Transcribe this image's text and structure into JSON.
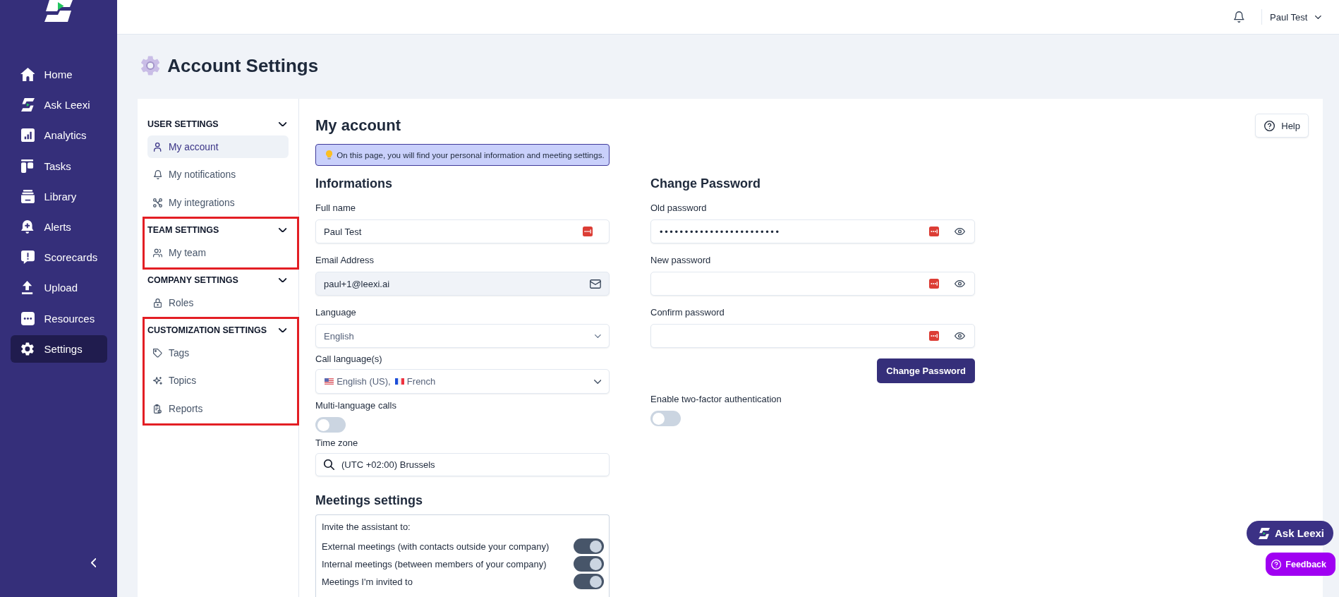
{
  "sidebar": {
    "items": [
      {
        "label": "Home",
        "selected": false
      },
      {
        "label": "Ask Leexi",
        "selected": false
      },
      {
        "label": "Analytics",
        "selected": false
      },
      {
        "label": "Tasks",
        "selected": false
      },
      {
        "label": "Library",
        "selected": false
      },
      {
        "label": "Alerts",
        "selected": false
      },
      {
        "label": "Scorecards",
        "selected": false
      },
      {
        "label": "Upload",
        "selected": false
      },
      {
        "label": "Resources",
        "selected": false
      },
      {
        "label": "Settings",
        "selected": true
      }
    ]
  },
  "top_bar": {
    "user_name": "Paul Test"
  },
  "page_title": "Account Settings",
  "settings_nav": {
    "sections": [
      {
        "title": "USER SETTINGS",
        "expanded": true,
        "highlighted": false,
        "items": [
          {
            "label": "My account",
            "selected": true
          },
          {
            "label": "My notifications",
            "selected": false
          },
          {
            "label": "My integrations",
            "selected": false
          }
        ]
      },
      {
        "title": "TEAM SETTINGS",
        "expanded": true,
        "highlighted": true,
        "items": [
          {
            "label": "My team",
            "selected": false
          }
        ]
      },
      {
        "title": "COMPANY SETTINGS",
        "expanded": true,
        "highlighted": false,
        "items": [
          {
            "label": "Roles",
            "selected": false
          }
        ]
      },
      {
        "title": "CUSTOMIZATION SETTINGS",
        "expanded": true,
        "highlighted": true,
        "items": [
          {
            "label": "Tags",
            "selected": false
          },
          {
            "label": "Topics",
            "selected": false
          },
          {
            "label": "Reports",
            "selected": false
          }
        ]
      }
    ]
  },
  "account": {
    "title": "My account",
    "help_button": "Help",
    "notice": "On this page, you will find your personal information and meeting settings.",
    "informations": {
      "title": "Informations",
      "fields": [
        {
          "kind": "text",
          "label": "Full name",
          "value": "Paul Test",
          "disabled": false
        },
        {
          "kind": "email",
          "label": "Email Address",
          "value": "paul+1@leexi.ai",
          "disabled": true
        },
        {
          "kind": "select",
          "label": "Language",
          "value": "English",
          "disabled": false
        },
        {
          "kind": "multiselect",
          "label": "Call language(s)",
          "options": [
            {
              "label": "English (US),"
            },
            {
              "label": "French"
            }
          ],
          "disabled": false
        },
        {
          "kind": "toggle",
          "label": "Multi-language calls",
          "on": false
        },
        {
          "kind": "search",
          "label": "Time zone",
          "value": "(UTC +02:00) Brussels",
          "disabled": false
        }
      ]
    },
    "meetings": {
      "title": "Meetings settings",
      "intro": "Invite the assistant to:",
      "options": [
        {
          "label": "External meetings (with contacts outside your company)",
          "on": true
        },
        {
          "label": "Internal meetings (between members of your company)",
          "on": true
        },
        {
          "label": "Meetings I'm invited to",
          "on": true
        }
      ]
    },
    "password": {
      "title": "Change Password",
      "fields": [
        {
          "label": "Old password",
          "value": "••••••••••••••••••••••••"
        },
        {
          "label": "New password"
        },
        {
          "label": "Confirm password"
        }
      ],
      "submit_button": "Change Password",
      "two_factor": {
        "label": "Enable two-factor authentication",
        "on": false
      }
    }
  },
  "floating_buttons": {
    "ask": "Ask Leexi",
    "feedback": "Feedback"
  }
}
